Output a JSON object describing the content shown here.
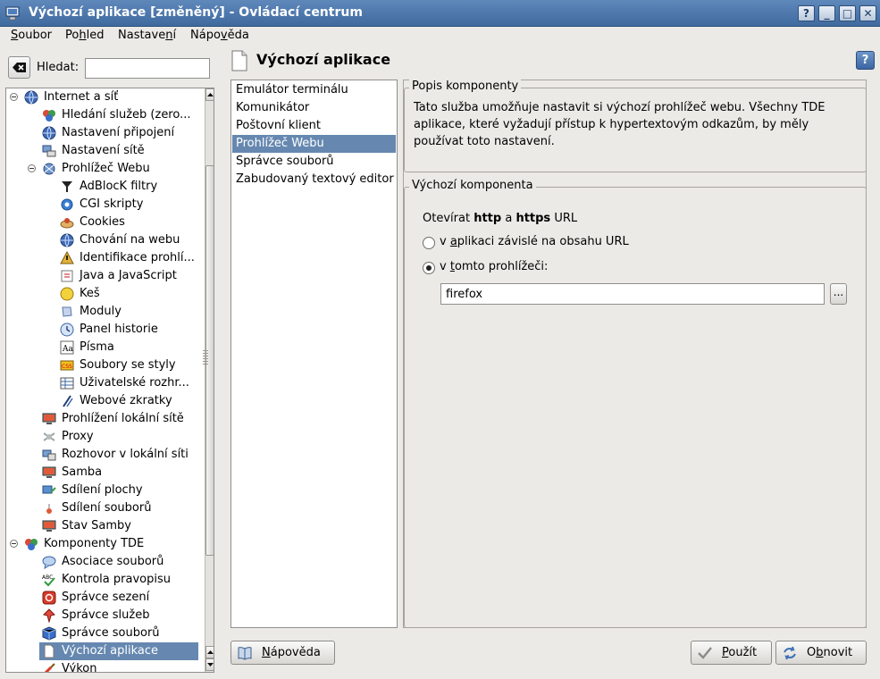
{
  "window": {
    "title": "Výchozí aplikace [změněný] - Ovládací centrum"
  },
  "titlebar_buttons": [
    "?",
    "_",
    "□",
    "✕"
  ],
  "menu": [
    {
      "label": "Soubor",
      "u": "S",
      "rest": "oubor",
      "pre": ""
    },
    {
      "label": "Pohled",
      "pre": "Po",
      "u": "h",
      "rest": "led"
    },
    {
      "label": "Nastavení",
      "pre": "Nastave",
      "u": "n",
      "rest": "í"
    },
    {
      "label": "Nápověda",
      "pre": "Nápo",
      "u": "v",
      "rest": "ěda"
    }
  ],
  "search": {
    "label": "Hledat:",
    "value": ""
  },
  "tree": [
    {
      "label": "Internet a síť",
      "level": 0,
      "exp": true,
      "icon": "globe-icon"
    },
    {
      "label": "Hledání služeb (zero...",
      "level": 1,
      "icon": "network-services-icon"
    },
    {
      "label": "Nastavení připojení",
      "level": 1,
      "icon": "globe-icon"
    },
    {
      "label": "Nastavení sítě",
      "level": 1,
      "icon": "network-computer-icon"
    },
    {
      "label": "Prohlížeč Webu",
      "level": 1,
      "exp": true,
      "icon": "web-browser-icon"
    },
    {
      "label": "AdBlocK filtry",
      "level": 2,
      "icon": "filter-icon"
    },
    {
      "label": "CGI skripty",
      "level": 2,
      "icon": "gear-icon"
    },
    {
      "label": "Cookies",
      "level": 2,
      "icon": "cookie-icon"
    },
    {
      "label": "Chování na webu",
      "level": 2,
      "icon": "globe-icon"
    },
    {
      "label": "Identifikace prohlí...",
      "level": 2,
      "icon": "warning-icon"
    },
    {
      "label": "Java a JavaScript",
      "level": 2,
      "icon": "java-icon"
    },
    {
      "label": "Keš",
      "level": 2,
      "icon": "cache-icon"
    },
    {
      "label": "Moduly",
      "level": 2,
      "icon": "plugin-icon"
    },
    {
      "label": "Panel historie",
      "level": 2,
      "icon": "history-icon"
    },
    {
      "label": "Písma",
      "level": 2,
      "icon": "font-icon"
    },
    {
      "label": "Soubory se styly",
      "level": 2,
      "icon": "css-icon"
    },
    {
      "label": "Uživatelské rozhr...",
      "level": 2,
      "icon": "table-icon"
    },
    {
      "label": "Webové zkratky",
      "level": 2,
      "icon": "shortcut-icon"
    },
    {
      "label": "Prohlížení lokální sítě",
      "level": 1,
      "icon": "monitor-icon"
    },
    {
      "label": "Proxy",
      "level": 1,
      "icon": "proxy-icon"
    },
    {
      "label": "Rozhovor v lokální síti",
      "level": 1,
      "icon": "chat-icon"
    },
    {
      "label": "Samba",
      "level": 1,
      "icon": "monitor-icon"
    },
    {
      "label": "Sdílení plochy",
      "level": 1,
      "icon": "desktop-share-icon"
    },
    {
      "label": "Sdílení souborů",
      "level": 1,
      "icon": "file-share-icon"
    },
    {
      "label": "Stav Samby",
      "level": 1,
      "icon": "monitor-icon"
    },
    {
      "label": "Komponenty TDE",
      "level": 0,
      "exp": true,
      "icon": "components-icon"
    },
    {
      "label": "Asociace souborů",
      "level": 1,
      "icon": "speech-bubble-icon"
    },
    {
      "label": "Kontrola pravopisu",
      "level": 1,
      "icon": "spellcheck-icon"
    },
    {
      "label": "Správce sezení",
      "level": 1,
      "icon": "power-icon"
    },
    {
      "label": "Správce služeb",
      "level": 1,
      "icon": "pin-icon"
    },
    {
      "label": "Správce souborů",
      "level": 1,
      "icon": "cube-icon"
    },
    {
      "label": "Výchozí aplikace",
      "level": 1,
      "icon": "page-icon",
      "selected": true
    },
    {
      "label": "Výkon",
      "level": 1,
      "icon": "brush-icon"
    }
  ],
  "page_title": "Výchozí aplikace",
  "components": [
    {
      "label": "Emulátor terminálu"
    },
    {
      "label": "Komunikátor"
    },
    {
      "label": "Poštovní klient"
    },
    {
      "label": "Prohlížeč Webu",
      "selected": true
    },
    {
      "label": "Správce souborů"
    },
    {
      "label": "Zabudovaný textový editor"
    }
  ],
  "description": {
    "title": "Popis komponenty",
    "text": "Tato služba umožňuje nastavit si výchozí prohlížeč webu. Všechny TDE aplikace, které vyžadují přístup k hypertextovým odkazům, by měly používat toto nastavení."
  },
  "default_component": {
    "title": "Výchozí komponenta",
    "open_pre": "Otevírat",
    "open_http": "http",
    "open_and": "a",
    "open_https": "https",
    "open_post": "URL",
    "radio1": {
      "pre": "v ",
      "u": "a",
      "rest": "plikaci závislé na obsahu URL",
      "checked": false
    },
    "radio2": {
      "pre": "v ",
      "u": "t",
      "rest": "omto prohlížeči:",
      "checked": true
    },
    "browser_value": "firefox",
    "browse_label": "..."
  },
  "buttons": {
    "help": {
      "u": "N",
      "rest": "ápověda"
    },
    "apply": {
      "u": "P",
      "rest": "oužít"
    },
    "reset": {
      "pre": "O",
      "u": "b",
      "rest": "novit"
    }
  }
}
